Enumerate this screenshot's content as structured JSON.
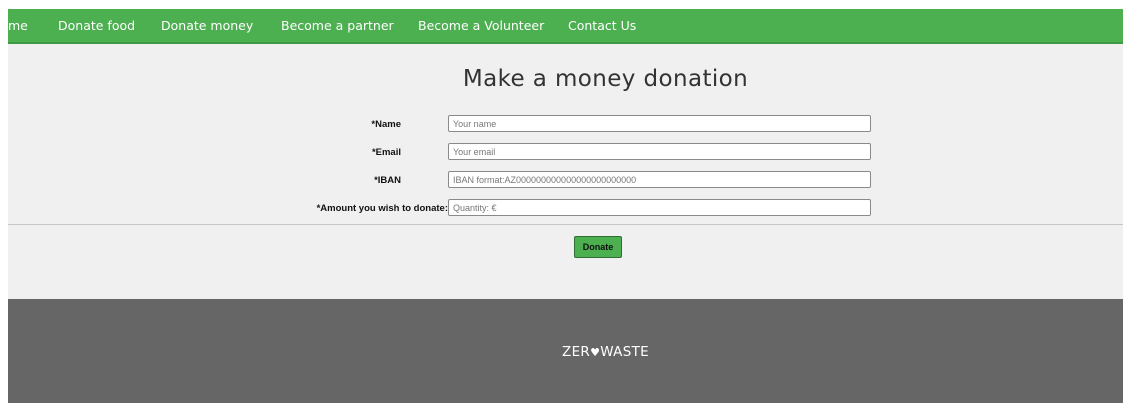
{
  "nav": {
    "items": [
      {
        "label": "me"
      },
      {
        "label": "Donate food"
      },
      {
        "label": "Donate money"
      },
      {
        "label": "Become a partner"
      },
      {
        "label": "Become a Volunteer"
      },
      {
        "label": "Contact Us"
      }
    ]
  },
  "main": {
    "title": "Make a money donation",
    "fields": [
      {
        "label": "*Name",
        "placeholder": "Your name"
      },
      {
        "label": "*Email",
        "placeholder": "Your email"
      },
      {
        "label": "*IBAN",
        "placeholder": "IBAN format:AZ000000000000000000000000"
      },
      {
        "label": "*Amount you wish to donate:",
        "placeholder": "Quantity: €"
      }
    ],
    "donate_label": "Donate"
  },
  "footer": {
    "logo_before": "ZER",
    "logo_heart": "♥",
    "logo_after": "WASTE"
  },
  "colors": {
    "nav_bg": "#4caf50",
    "page_bg": "#f0f0f0",
    "footer_bg": "#666666",
    "button_bg": "#4caf50"
  }
}
